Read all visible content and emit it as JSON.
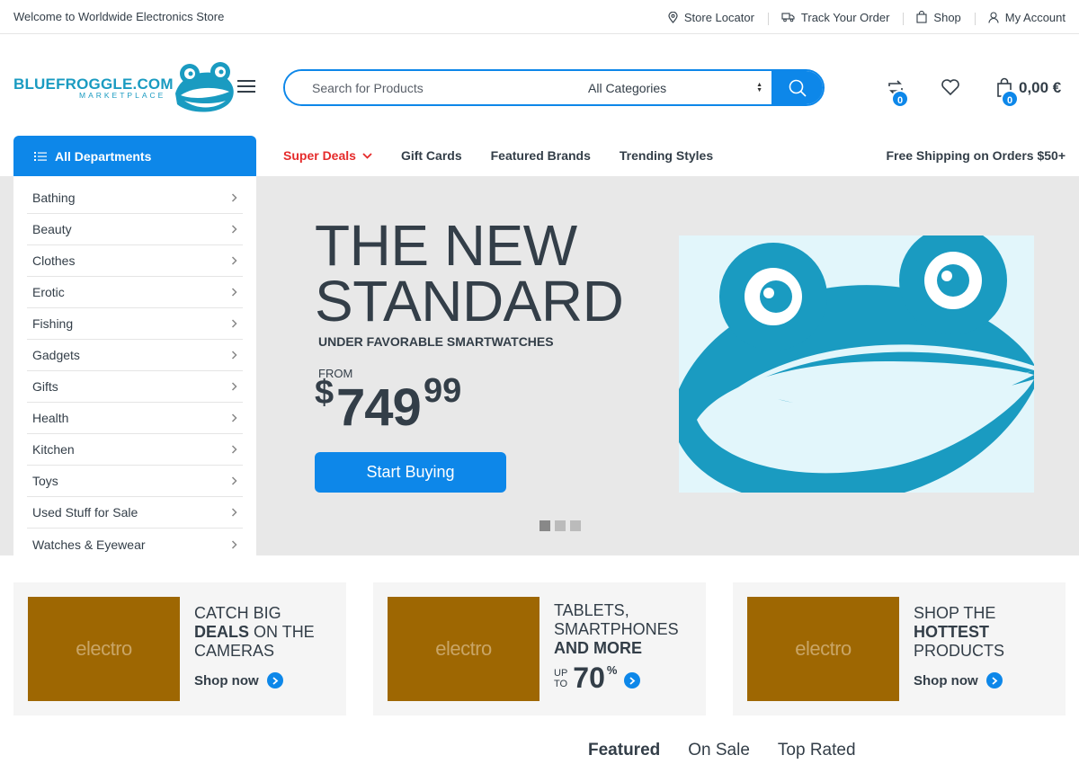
{
  "topbar": {
    "welcome": "Welcome to Worldwide Electronics Store",
    "links": [
      {
        "label": "Store Locator",
        "icon": "map-pin-icon"
      },
      {
        "label": "Track Your Order",
        "icon": "truck-icon"
      },
      {
        "label": "Shop",
        "icon": "shopping-bag-icon"
      },
      {
        "label": "My Account",
        "icon": "user-icon"
      }
    ]
  },
  "logo": {
    "wordmark": "BLUEFROGGLE.COM",
    "sub": "MARKETPLACE"
  },
  "search": {
    "placeholder": "Search for Products",
    "category": "All Categories"
  },
  "header": {
    "compare_count": "0",
    "cart_count": "0",
    "cart_total": "0,00 €"
  },
  "nav": {
    "departments": "All Departments",
    "items": [
      "Super Deals",
      "Gift Cards",
      "Featured Brands",
      "Trending Styles"
    ],
    "shipping": "Free Shipping on Orders $50+"
  },
  "categories": [
    "Bathing",
    "Beauty",
    "Clothes",
    "Erotic",
    "Fishing",
    "Gadgets",
    "Gifts",
    "Health",
    "Kitchen",
    "Toys",
    "Used Stuff for Sale",
    "Watches & Eyewear"
  ],
  "hero": {
    "title_line1": "THE NEW",
    "title_line2": "STANDARD",
    "subtitle": "UNDER FAVORABLE SMARTWATCHES",
    "from": "FROM",
    "currency": "$",
    "price_int": "749",
    "price_dec": "99",
    "button": "Start Buying",
    "slides": 3,
    "active_slide": 1
  },
  "promos": [
    {
      "img_text": "electro",
      "line1": "CATCH BIG",
      "bold": "DEALS",
      "rest1": " ON THE",
      "line3": "CAMERAS",
      "cta": "Shop now"
    },
    {
      "img_text": "electro",
      "line1": "TABLETS,",
      "line2": "SMARTPHONES",
      "bold": "AND MORE",
      "up": "UP",
      "to": "TO",
      "pct": "70",
      "pct_sign": "%"
    },
    {
      "img_text": "electro",
      "line1": "SHOP THE",
      "bold": "HOTTEST",
      "line3": "PRODUCTS",
      "cta": "Shop now"
    }
  ],
  "tabs": [
    "Featured",
    "On Sale",
    "Top Rated"
  ],
  "colors": {
    "accent": "#0d87e9",
    "deal_red": "#e52b2b",
    "text": "#333e48",
    "logo": "#1a9bc1",
    "promo_img": "#9e6702"
  }
}
